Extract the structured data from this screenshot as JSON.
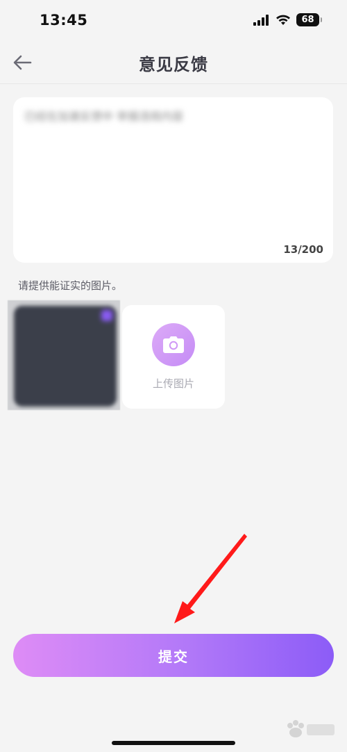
{
  "status_bar": {
    "time": "13:45",
    "battery": "68",
    "icons": [
      "signal-icon",
      "wifi-icon",
      "battery-icon"
    ]
  },
  "nav": {
    "title": "意见反馈",
    "back_icon": "back-arrow-icon"
  },
  "feedback": {
    "text": "已经在加速反馈中 举报违规内容",
    "char_count": "13/200"
  },
  "images": {
    "hint": "请提供能证实的图片。",
    "upload_label": "上传图片",
    "upload_icon": "camera-icon"
  },
  "submit": {
    "label": "提交"
  },
  "colors": {
    "background": "#f4f4f4",
    "accent_start": "#de8cf6",
    "accent_end": "#8c5cf7",
    "annotation_arrow": "#ff1a1a"
  }
}
